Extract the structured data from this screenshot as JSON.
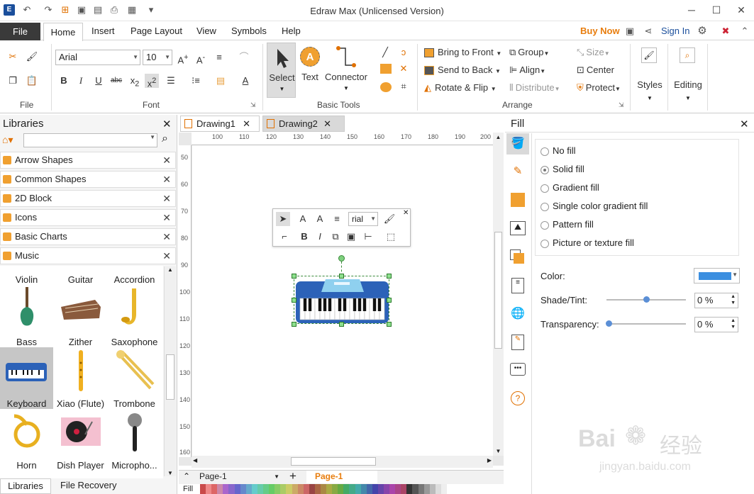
{
  "app": {
    "title": "Edraw Max (Unlicensed Version)"
  },
  "quick_access": [
    "logo-icon",
    "undo-icon",
    "redo-icon",
    "new-icon",
    "open-icon",
    "save-icon",
    "print-icon",
    "export-icon",
    "more-icon"
  ],
  "menu": {
    "file": "File",
    "tabs": [
      "Home",
      "Insert",
      "Page Layout",
      "View",
      "Symbols",
      "Help"
    ],
    "buy_now": "Buy Now",
    "sign_in": "Sign In"
  },
  "ribbon": {
    "font_name": "Arial",
    "font_size": "10",
    "groups": {
      "file": "File",
      "font": "Font",
      "basic_tools": "Basic Tools",
      "arrange": "Arrange"
    },
    "tools": {
      "select": "Select",
      "text": "Text",
      "connector": "Connector"
    },
    "arrange": {
      "bring_to_front": "Bring to Front",
      "send_to_back": "Send to Back",
      "rotate_flip": "Rotate & Flip",
      "group": "Group",
      "align": "Align",
      "distribute": "Distribute",
      "size": "Size",
      "center": "Center",
      "protect": "Protect"
    },
    "styles": "Styles",
    "editing": "Editing"
  },
  "libraries": {
    "title": "Libraries",
    "items": [
      "Arrow Shapes",
      "Common Shapes",
      "2D Block",
      "Icons",
      "Basic Charts",
      "Music"
    ],
    "symbols": [
      "Violin",
      "Guitar",
      "Accordion",
      "Bass",
      "Zither",
      "Saxophone",
      "Keyboard",
      "Xiao (Flute)",
      "Trombone",
      "Horn",
      "Dish Player",
      "Micropho..."
    ],
    "bottom_tabs": [
      "Libraries",
      "File Recovery"
    ]
  },
  "documents": {
    "tabs": [
      "Drawing1",
      "Drawing2"
    ],
    "active": "Drawing2"
  },
  "ruler": {
    "h": [
      "100",
      "110",
      "120",
      "130",
      "140",
      "150",
      "160",
      "170",
      "180",
      "190",
      "200"
    ],
    "v": [
      "50",
      "60",
      "70",
      "80",
      "90",
      "100",
      "110",
      "120",
      "130",
      "140",
      "150",
      "160"
    ]
  },
  "float_toolbar": {
    "font": "rial"
  },
  "pages": {
    "selector": "Page-1",
    "current": "Page-1",
    "fill_label": "Fill"
  },
  "fill_panel": {
    "title": "Fill",
    "options": [
      "No fill",
      "Solid fill",
      "Gradient fill",
      "Single color gradient fill",
      "Pattern fill",
      "Picture or texture fill"
    ],
    "selected": "Solid fill",
    "color_label": "Color:",
    "color_value": "#3c8fe0",
    "shade_label": "Shade/Tint:",
    "shade_value": "0 %",
    "transparency_label": "Transparency:",
    "transparency_value": "0 %"
  },
  "colors": {
    "accent": "#e87d0d",
    "file_tab": "#3a3a3a",
    "orange": "#f0a030"
  },
  "watermark": {
    "text1": "Bai",
    "text2": "经验",
    "url": "jingyan.baidu.com"
  }
}
